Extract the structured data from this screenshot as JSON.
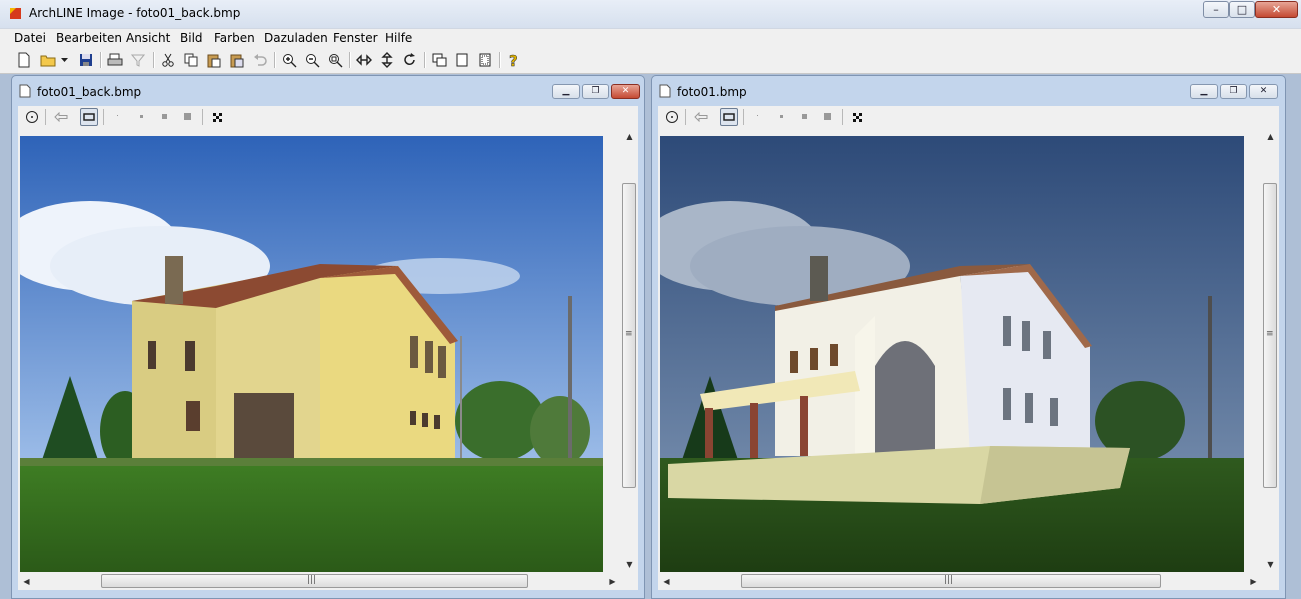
{
  "window": {
    "title": "ArchLINE Image - foto01_back.bmp",
    "controls": {
      "minimize": "–",
      "maximize": "□",
      "close": "✕"
    }
  },
  "menu": [
    "Datei",
    "Bearbeiten",
    "Ansicht",
    "Bild",
    "Farben",
    "Dazuladen",
    "Fenster",
    "Hilfe"
  ],
  "toolbar": {
    "icons": [
      "new-icon",
      "open-icon",
      "dropdown-icon",
      "save-icon",
      "print-icon",
      "filter-icon",
      "cut-icon",
      "copy-icon",
      "paste-icon",
      "paste-special-icon",
      "undo-icon",
      "zoom-in-icon",
      "zoom-out-icon",
      "zoom-fit-icon",
      "flip-horizontal-icon",
      "flip-vertical-icon",
      "rotate-icon",
      "window-overlay-icon",
      "window-single-icon",
      "window-frame-icon",
      "help-icon"
    ]
  },
  "children": [
    {
      "caption": "foto01_back.bmp",
      "tools": [
        "target-icon",
        "back-arrow-icon",
        "rectangle-select-icon",
        "dot-small-icon",
        "dot-medium-icon",
        "dot-large-icon",
        "dot-xlarge-icon",
        "checker-icon"
      ],
      "image": {
        "kind": "photo",
        "subject": "old yellow farmhouse"
      }
    },
    {
      "caption": "foto01.bmp",
      "tools": [
        "target-icon",
        "back-arrow-icon",
        "rectangle-select-icon",
        "dot-small-icon",
        "dot-medium-icon",
        "dot-large-icon",
        "dot-xlarge-icon",
        "checker-icon"
      ],
      "image": {
        "kind": "render",
        "subject": "renovated white villa rendering"
      }
    }
  ],
  "colors": {
    "titlebar": "#dce6f2",
    "sky": "#3f74c4",
    "grass": "#3f7a24",
    "close_button": "#c44a33"
  }
}
